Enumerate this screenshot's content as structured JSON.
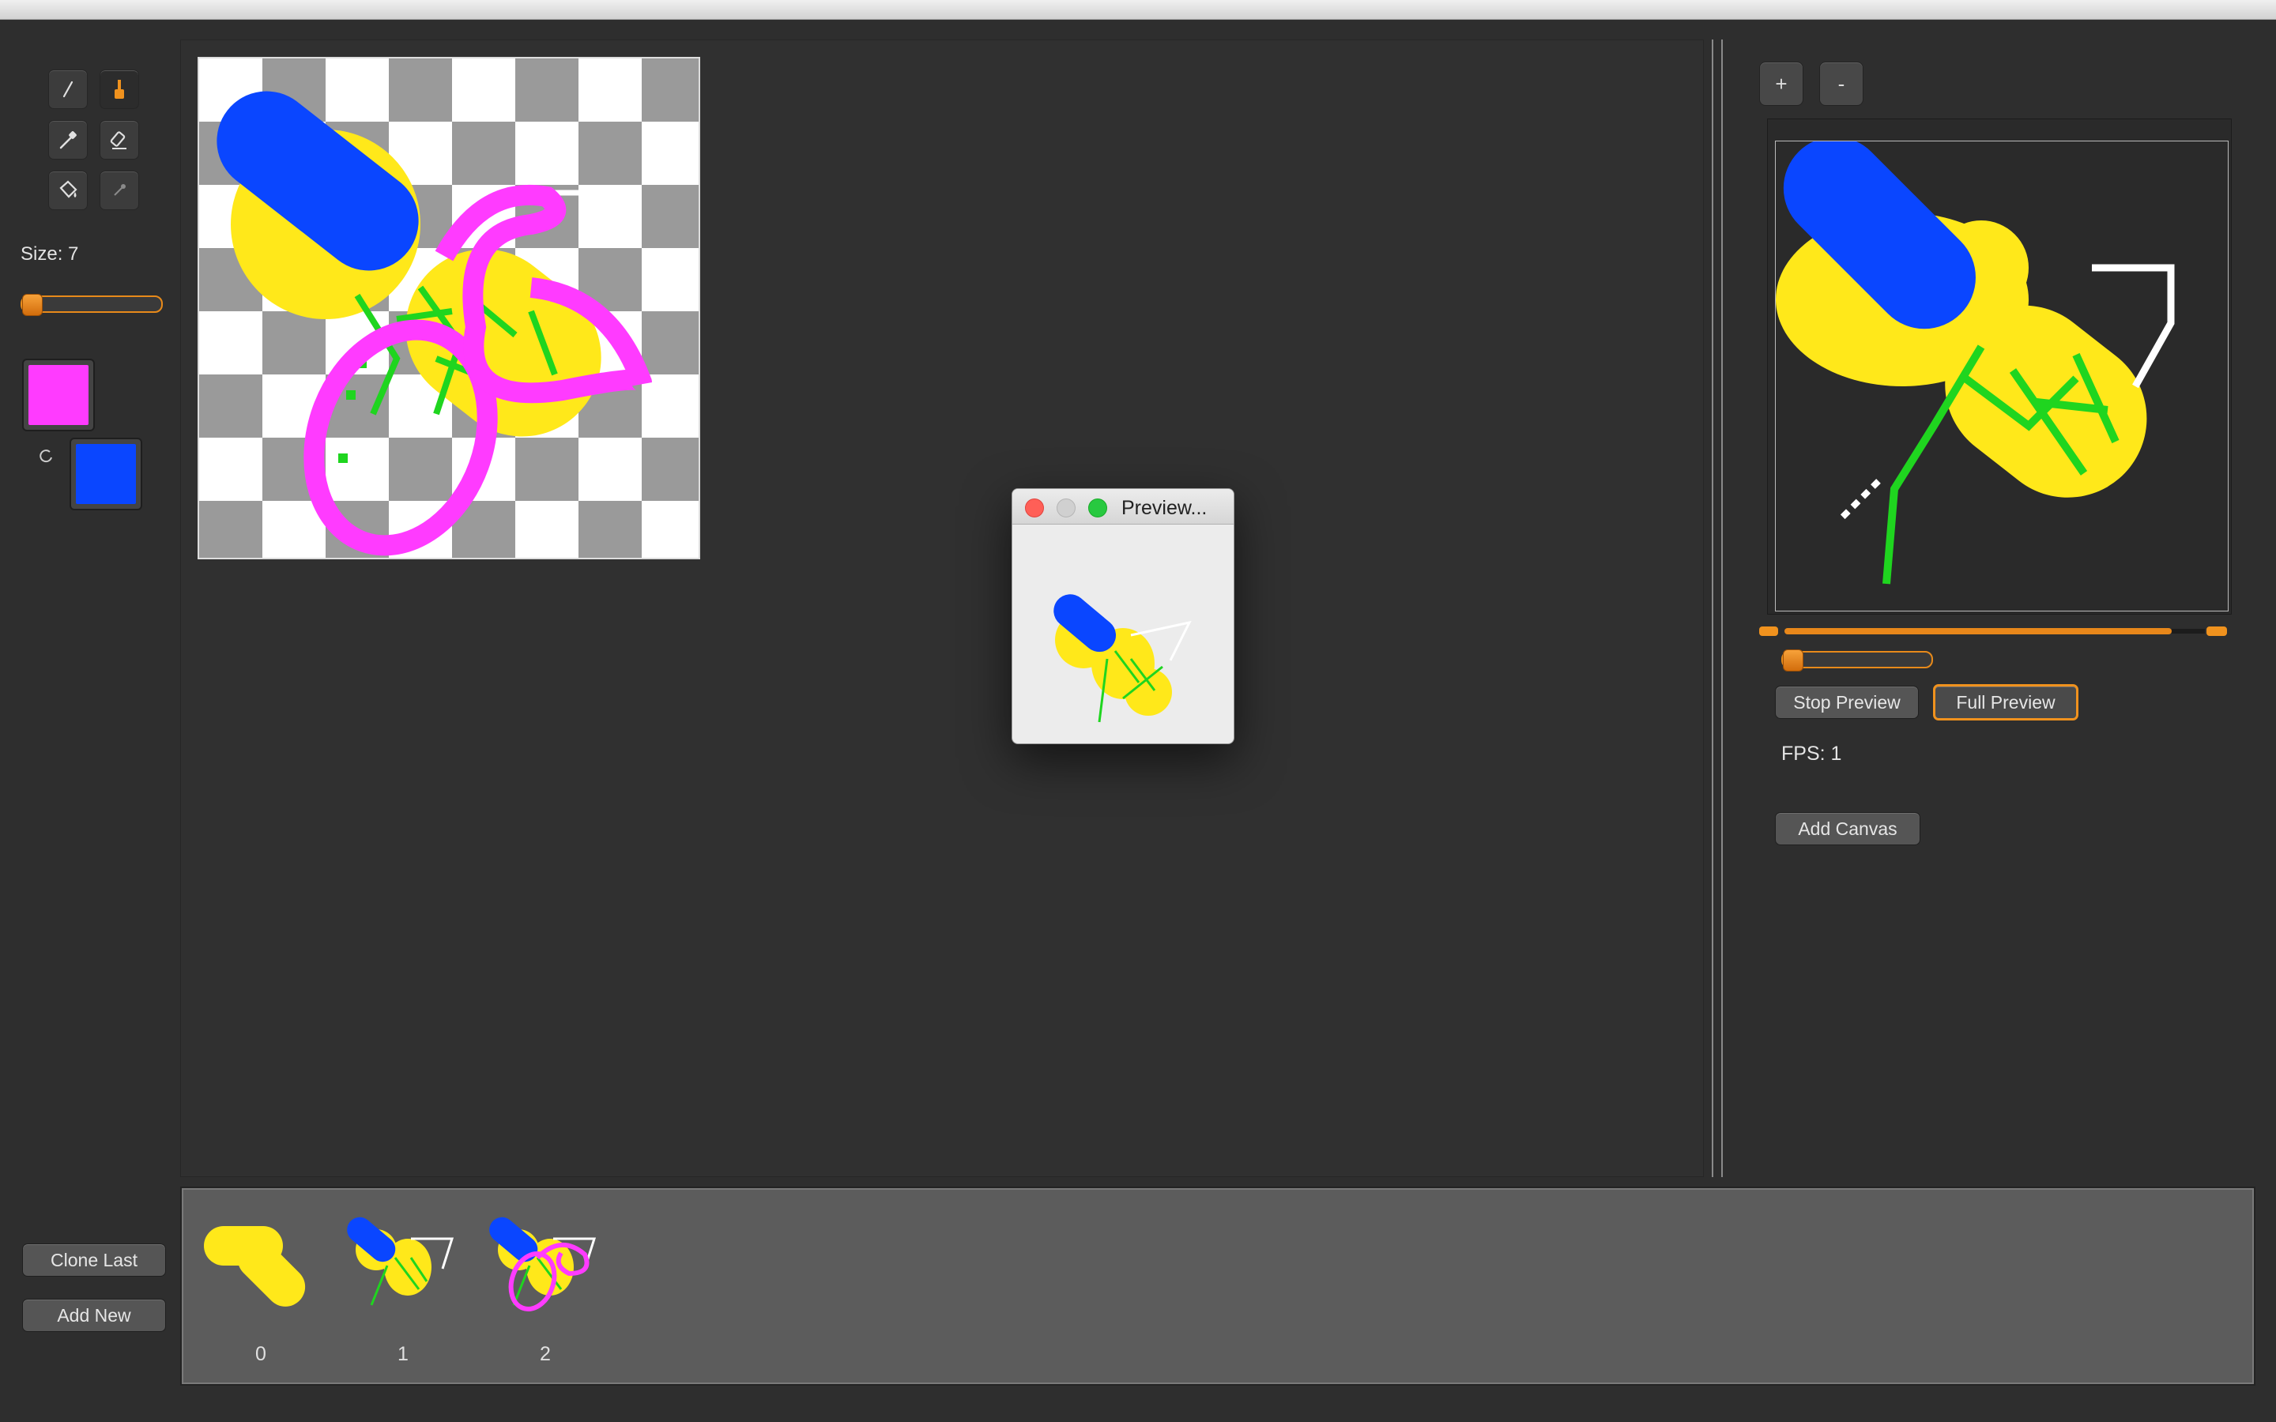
{
  "app": {
    "title": ""
  },
  "tools": [
    {
      "name": "pencil-icon",
      "active": false
    },
    {
      "name": "brush-icon",
      "active": true
    },
    {
      "name": "eyedropper-icon",
      "active": false
    },
    {
      "name": "eraser-icon",
      "active": false
    },
    {
      "name": "paint-bucket-icon",
      "active": false
    },
    {
      "name": "magic-wand-icon",
      "active": false
    }
  ],
  "brush": {
    "size_label": "Size: 7",
    "size": 7
  },
  "colors": {
    "primary": "#ff3bff",
    "secondary": "#0a46ff",
    "accent": "#f0921e"
  },
  "left_buttons": {
    "clone_last": "Clone Last",
    "add_new": "Add New"
  },
  "preview_window": {
    "title": "Preview..."
  },
  "right_panel": {
    "zoom_in": "+",
    "zoom_out": "-",
    "stop_preview": "Stop Preview",
    "full_preview": "Full Preview",
    "fps_label": "FPS: 1",
    "fps": 1,
    "add_canvas": "Add Canvas"
  },
  "frames": [
    {
      "label": "0"
    },
    {
      "label": "1"
    },
    {
      "label": "2"
    }
  ]
}
